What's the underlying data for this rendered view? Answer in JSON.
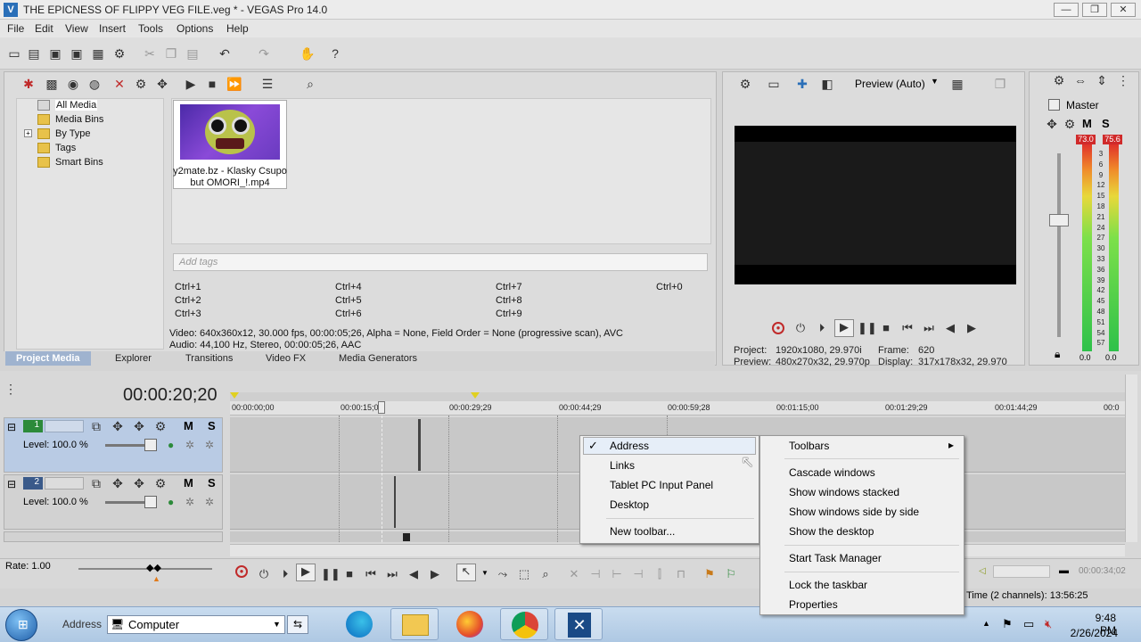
{
  "window": {
    "title": "THE EPICNESS OF FLIPPY VEG FILE.veg * - VEGAS Pro 14.0",
    "minimize": "—",
    "maximize": "❐",
    "close": "✕"
  },
  "menu": [
    "File",
    "Edit",
    "View",
    "Insert",
    "Tools",
    "Options",
    "Help"
  ],
  "media": {
    "tree": [
      "All Media",
      "Media Bins",
      "By Type",
      "Tags",
      "Smart Bins"
    ],
    "expander": "+",
    "thumb_caption_1": "y2mate.bz - Klasky Csupo",
    "thumb_caption_2": "but OMORI_!.mp4",
    "tags_placeholder": "Add tags",
    "shortcuts": [
      [
        "Ctrl+1",
        "Ctrl+4",
        "Ctrl+7",
        "Ctrl+0"
      ],
      [
        "Ctrl+2",
        "Ctrl+5",
        "Ctrl+8",
        ""
      ],
      [
        "Ctrl+3",
        "Ctrl+6",
        "Ctrl+9",
        ""
      ]
    ],
    "video_info": "Video: 640x360x12, 30.000 fps, 00:00:05;26, Alpha = None, Field Order = None (progressive scan), AVC",
    "audio_info": "Audio: 44,100 Hz, Stereo, 00:00:05;26, AAC",
    "tabs": [
      "Project Media",
      "Explorer",
      "Transitions",
      "Video FX",
      "Media Generators"
    ]
  },
  "preview": {
    "mode": "Preview (Auto)",
    "project_label": "Project:",
    "project_value": "1920x1080, 29.970i",
    "frame_label": "Frame:",
    "frame_value": "620",
    "preview_label": "Preview:",
    "preview_value": "480x270x32, 29.970p",
    "display_label": "Display:",
    "display_value": "317x178x32, 29.970"
  },
  "master": {
    "label": "Master",
    "mute": "M",
    "solo": "S",
    "peak_left": "73.0",
    "peak_right": "75.6",
    "scale": [
      "3",
      "6",
      "9",
      "12",
      "15",
      "18",
      "21",
      "24",
      "27",
      "30",
      "33",
      "36",
      "39",
      "42",
      "45",
      "48",
      "51",
      "54",
      "57"
    ],
    "bottom_left": "0.0",
    "bottom_right": "0.0"
  },
  "timeline": {
    "timecode": "00:00:20;20",
    "ruler": [
      "00:00:00;00",
      "00:00:15;00",
      "00:00:29;29",
      "00:00:44;29",
      "00:00:59;28",
      "00:01:15;00",
      "00:01:29;29",
      "00:01:44;29",
      "00:0"
    ],
    "tracks": [
      {
        "num": "1",
        "level": "Level: 100.0 %",
        "m": "M",
        "s": "S"
      },
      {
        "num": "2",
        "level": "Level: 100.0 %",
        "m": "M",
        "s": "S"
      }
    ],
    "rate": "Rate: 1.00",
    "record_time": "d Time (2 channels): 13:56:25",
    "end_time": "00:00:34;02"
  },
  "context_menu": {
    "left": [
      {
        "label": "Address",
        "checked": true
      },
      {
        "label": "Links"
      },
      {
        "label": "Tablet PC Input Panel"
      },
      {
        "label": "Desktop"
      },
      {
        "label": "New toolbar..."
      }
    ],
    "right": [
      "Toolbars",
      "Cascade windows",
      "Show windows stacked",
      "Show windows side by side",
      "Show the desktop",
      "Start Task Manager",
      "Lock the taskbar",
      "Properties"
    ],
    "check": "✓",
    "submenu_arrow": "▸"
  },
  "taskbar": {
    "address_label": "Address",
    "address_value": "Computer",
    "time": "9:48 PM",
    "date": "2/26/2024"
  }
}
